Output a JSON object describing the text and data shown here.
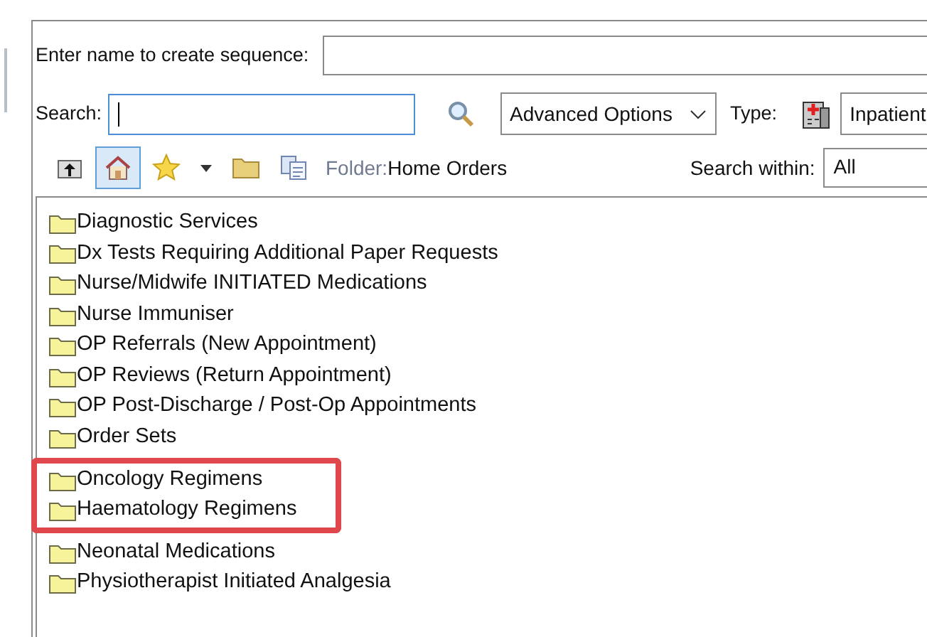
{
  "sequence_name": {
    "label": "Enter name to create sequence:"
  },
  "search": {
    "label": "Search:"
  },
  "advanced_options": {
    "value": "Advanced Options"
  },
  "type": {
    "label": "Type:",
    "value": "Inpatient"
  },
  "toolbar": [
    {
      "kind": "up",
      "selected": false
    },
    {
      "kind": "home",
      "selected": true
    },
    {
      "kind": "star",
      "selected": false
    },
    {
      "kind": "caret",
      "selected": false
    },
    {
      "kind": "folder",
      "selected": false
    },
    {
      "kind": "copy",
      "selected": false
    }
  ],
  "folder": {
    "label": "Folder:",
    "value": "Home Orders"
  },
  "search_within": {
    "label": "Search within:",
    "value": "All"
  },
  "folders": [
    {
      "name": "Diagnostic Services",
      "highlighted": false
    },
    {
      "name": "Dx Tests Requiring Additional Paper Requests",
      "highlighted": false
    },
    {
      "name": "Nurse/Midwife INITIATED Medications",
      "highlighted": false
    },
    {
      "name": "Nurse Immuniser",
      "highlighted": false
    },
    {
      "name": "OP Referrals (New Appointment)",
      "highlighted": false
    },
    {
      "name": "OP Reviews (Return Appointment)",
      "highlighted": false
    },
    {
      "name": "OP Post-Discharge / Post-Op Appointments",
      "highlighted": false
    },
    {
      "name": "Order Sets",
      "highlighted": false
    },
    {
      "name": "Oncology Regimens",
      "highlighted": true
    },
    {
      "name": "Haematology Regimens",
      "highlighted": true
    },
    {
      "name": "Neonatal Medications",
      "highlighted": false
    },
    {
      "name": "Physiotherapist Initiated Analgesia",
      "highlighted": false
    }
  ]
}
